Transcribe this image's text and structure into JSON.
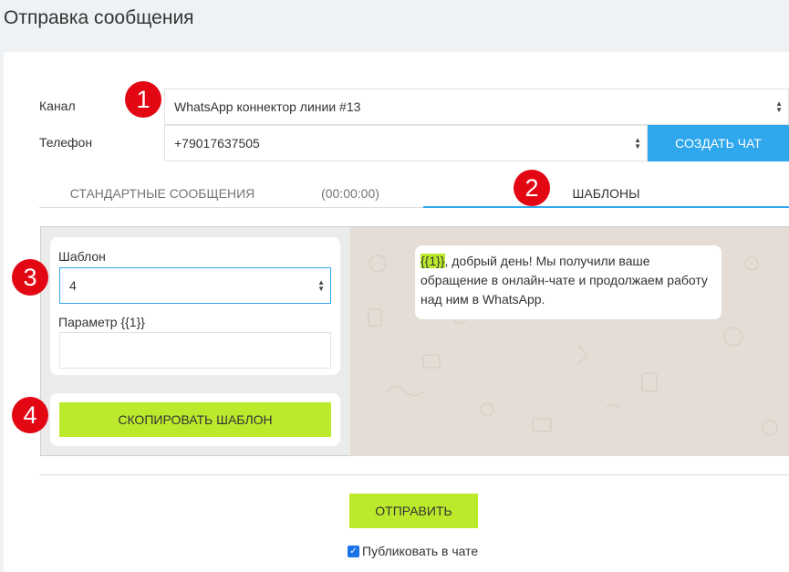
{
  "page": {
    "title": "Отправка сообщения"
  },
  "form": {
    "channel_label": "Канал",
    "channel_value": "WhatsApp коннектор линии #13",
    "phone_label": "Телефон",
    "phone_value": "+79017637505",
    "create_chat_label": "СОЗДАТЬ ЧАТ"
  },
  "tabs": {
    "standard_label": "СТАНДАРТНЫЕ СООБЩЕНИЯ",
    "timer": "(00:00:00)",
    "templates_label": "ШАБЛОНЫ"
  },
  "template": {
    "template_label": "Шаблон",
    "template_value": "4",
    "param_label": "Параметр {{1}}",
    "param_value": "",
    "copy_label": "СКОПИРОВАТЬ ШАБЛОН"
  },
  "preview": {
    "placeholder": "{{1}}",
    "message": ", добрый день! Мы получили ваше обращение в онлайн-чате и продолжаем работу над ним в WhatsApp."
  },
  "footer": {
    "send_label": "ОТПРАВИТЬ",
    "publish_label": "Публиковать в чате",
    "publish_checked": true
  },
  "badges": [
    "1",
    "2",
    "3",
    "4"
  ],
  "colors": {
    "accent_blue": "#2fa7ec",
    "accent_green": "#bbea2d",
    "badge_red": "#e30613"
  }
}
